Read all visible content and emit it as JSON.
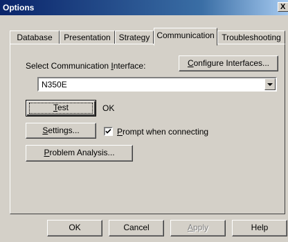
{
  "window": {
    "title": "Options",
    "close_glyph": "X"
  },
  "tabs": [
    {
      "label": "Database"
    },
    {
      "label": "Presentation"
    },
    {
      "label": "Strategy"
    },
    {
      "label": "Communication",
      "active": true
    },
    {
      "label": "Troubleshooting"
    }
  ],
  "communication": {
    "interface_label_pre": "Select Communication ",
    "interface_label_ul": "I",
    "interface_label_post": "nterface:",
    "configure_ul": "C",
    "configure_post": "onfigure Interfaces...",
    "interface_value": "N350E",
    "test_ul": "T",
    "test_post": "est",
    "test_status": "OK",
    "settings_ul": "S",
    "settings_post": "ettings...",
    "prompt_checked": true,
    "prompt_ul": "P",
    "prompt_post": "rompt when connecting",
    "problem_ul": "P",
    "problem_post": "roblem Analysis..."
  },
  "footer": {
    "ok": "OK",
    "cancel": "Cancel",
    "apply_ul": "A",
    "apply_post": "pply",
    "help": "Help"
  }
}
